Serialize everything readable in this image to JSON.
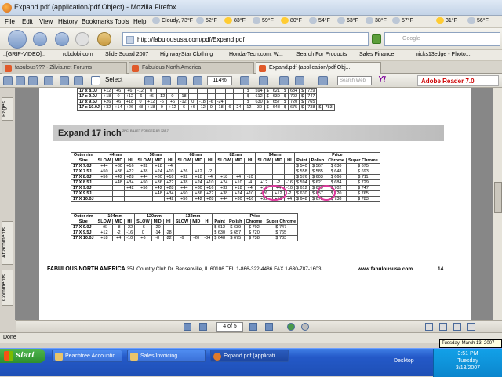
{
  "window": {
    "title": "Expand.pdf (application/pdf Object) - Mozilla Firefox"
  },
  "menu": [
    "File",
    "Edit",
    "View",
    "History",
    "Bookmarks",
    "Tools",
    "Help"
  ],
  "weather": [
    {
      "label": "Cloudy, 73°F",
      "icon": "cloud-icon"
    },
    {
      "label": "52°F",
      "icon": "cloud-icon"
    },
    {
      "label": "83°F",
      "icon": "sun-icon"
    },
    {
      "label": "59°F",
      "icon": "cloud-icon"
    },
    {
      "label": "80°F",
      "icon": "sun-icon"
    },
    {
      "label": "54°F",
      "icon": "cloud-icon"
    },
    {
      "label": "63°F",
      "icon": "cloud-icon"
    },
    {
      "label": "38°F",
      "icon": "cloud-icon"
    },
    {
      "label": "57°F",
      "icon": "cloud-icon"
    },
    {
      "label": "31°F",
      "icon": "sun-icon"
    },
    {
      "label": "56°F",
      "icon": "cloud-icon"
    }
  ],
  "url": "http://fabuloususa.com/pdf/Expand.pdf",
  "search_placeholder": "Google",
  "bookmarks": [
    "::[GRIP-VIDEO]::",
    "robdobi.com",
    "Slide Squad 2007",
    "HighwayStar Clothing",
    "Honda-Tech.com: W...",
    "Search For Products",
    "Sales Finance",
    "nicks13edge - Photo..."
  ],
  "tabs": [
    {
      "label": "fabulous??? - Zilvia.net Forums",
      "active": false
    },
    {
      "label": "Fabulous North America",
      "active": false
    },
    {
      "label": "Expand.pdf (application/pdf Obj...",
      "active": true
    }
  ],
  "reader": {
    "select_label": "Select",
    "zoom": "114%",
    "search_placeholder": "Search Web",
    "yahoo": "Y!",
    "brand": "Adobe Reader 7.0"
  },
  "left_tabs": [
    "Pages",
    "Attachments",
    "Comments"
  ],
  "pdf": {
    "top_rows": [
      [
        "17 x 8.0J",
        "+12",
        "+6",
        "+6",
        "-12",
        "0",
        "",
        "",
        "",
        "",
        "",
        "",
        "",
        "",
        "",
        "$",
        "594",
        "$",
        "621",
        "$",
        "684",
        "$",
        "729"
      ],
      [
        "17 x 9.0J",
        "+18",
        "0",
        "+12",
        "-6",
        "+6",
        "-12",
        "0",
        "-18",
        "",
        "",
        "",
        "",
        "",
        "",
        "$",
        "612",
        "$",
        "639",
        "$",
        "702",
        "$",
        "747"
      ],
      [
        "17 x 9.5J",
        "+26",
        "+6",
        "+18",
        "0",
        "+12",
        "-6",
        "+6",
        "-12",
        "0",
        "-18",
        "-6",
        "-24",
        "",
        "",
        "$",
        "630",
        "$",
        "657",
        "$",
        "720",
        "$",
        "765"
      ],
      [
        "17 x 10.0J",
        "+32",
        "+14",
        "+26",
        "+8",
        "+18",
        "0",
        "+12",
        "-6",
        "+6",
        "-12",
        "0",
        "-18",
        "-6",
        "-24",
        "-12",
        "-30",
        "$",
        "648",
        "$",
        "675",
        "$",
        "738",
        "$",
        "783"
      ]
    ],
    "section_title": "Expand 17 inch",
    "section_sub": "2PC. BILLET FORGED 8R 128.7",
    "t1_groups": [
      "Outer rim",
      "44mm",
      "56mm",
      "68mm",
      "82mm",
      "94mm",
      "Price"
    ],
    "t1_cols": [
      "Size",
      "SLOW",
      "MID",
      "HI",
      "SLOW",
      "MID",
      "HI",
      "SLOW",
      "MID",
      "HI",
      "SLOW",
      "MID",
      "HI",
      "SLOW",
      "MID",
      "HI",
      "Paint",
      "Polish",
      "Chrome",
      "Super Chrome"
    ],
    "t1_rows": [
      [
        "17 X 7.0J",
        "+44",
        "+30",
        "+16",
        "+32",
        "+18",
        "+4",
        "",
        "",
        "",
        "",
        "",
        "",
        "",
        "",
        "",
        "$ 540",
        "$ 567",
        "$ 630",
        "$ 675"
      ],
      [
        "17 X 7.5J",
        "+50",
        "+36",
        "+22",
        "+38",
        "+24",
        "+10",
        "+26",
        "+12",
        "-2",
        "",
        "",
        "",
        "",
        "",
        "",
        "$ 558",
        "$ 585",
        "$ 648",
        "$ 693"
      ],
      [
        "17 X 8.0J",
        "+56",
        "+42",
        "+28",
        "+44",
        "+30",
        "+16",
        "+32",
        "+18",
        "+4",
        "+18",
        "+4",
        "-10",
        "",
        "",
        "",
        "$ 576",
        "$ 603",
        "$ 666",
        "$ 711"
      ],
      [
        "17 X 8.5J",
        "",
        "+48",
        "+34",
        "+50",
        "+36",
        "+22",
        "+38",
        "+24",
        "+10",
        "+24",
        "+10",
        "-4",
        "+12",
        "-2",
        "-16",
        "$ 594",
        "$ 621",
        "$ 684",
        "$ 729"
      ],
      [
        "17 X 9.0J",
        "",
        "",
        "+42",
        "+56",
        "+42",
        "+28",
        "+44",
        "+30",
        "+16",
        "+32",
        "+18",
        "+4",
        "+18",
        "+4",
        "-10",
        "$ 612",
        "$ 639",
        "$ 702",
        "$ 747"
      ],
      [
        "17 X 9.5J",
        "",
        "",
        "",
        "",
        "+48",
        "+34",
        "+50",
        "+36",
        "+22",
        "+38",
        "+24",
        "+10",
        "+26",
        "+12",
        "-2",
        "$ 630",
        "$ 657",
        "$ 720",
        "$ 765"
      ],
      [
        "17 X 10.0J",
        "",
        "",
        "",
        "",
        "",
        "+42",
        "+56",
        "+42",
        "+28",
        "+44",
        "+30",
        "+16",
        "+32",
        "+18",
        "+4",
        "$ 648",
        "$ 675",
        "$ 738",
        "$ 783"
      ]
    ],
    "t2_groups": [
      "Outer rim",
      "104mm",
      "120mm",
      "132mm",
      "Price"
    ],
    "t2_cols": [
      "Size",
      "SLOW",
      "MID",
      "HI",
      "SLOW",
      "MID",
      "HI",
      "SLOW",
      "MID",
      "HI",
      "Paint",
      "Polish",
      "Chrome",
      "Super Chrome"
    ],
    "t2_rows": [
      [
        "17 X 9.0J",
        "+6",
        "-8",
        "-22",
        "-6",
        "-20",
        "",
        "",
        "",
        "",
        "$ 612",
        "$ 639",
        "$ 702",
        "$ 747"
      ],
      [
        "17 X 9.5J",
        "+12",
        "-2",
        "-16",
        "0",
        "-14",
        "-28",
        "",
        "",
        "",
        "$ 630",
        "$ 657",
        "$ 720",
        "$ 765"
      ],
      [
        "17 X 10.0J",
        "+18",
        "+4",
        "-10",
        "+6",
        "-8",
        "-22",
        "-6",
        "-20",
        "-34",
        "$ 648",
        "$ 675",
        "$ 738",
        "$ 783"
      ]
    ],
    "footer_company": "FABULOUS NORTH AMERICA",
    "footer_address": "351 Country Club Dr. Bensenville, IL 60106   TEL 1-866-322-4486   FAX 1-630-787-1603",
    "footer_url": "www.fabuloususa.com",
    "footer_page": "14"
  },
  "page_nav": {
    "current": "4 of 5"
  },
  "status": "Done",
  "tooltip": "Tuesday, March 13, 2007",
  "taskbar": {
    "start": "start",
    "tasks": [
      {
        "label": "Peachtree Accountin...",
        "active": false
      },
      {
        "label": "Sales/Invoicing",
        "active": false
      },
      {
        "label": "Expand.pdf (applicati...",
        "active": true
      }
    ],
    "desktop": "Desktop",
    "time": "3:51 PM",
    "day": "Tuesday",
    "date": "3/13/2007"
  }
}
